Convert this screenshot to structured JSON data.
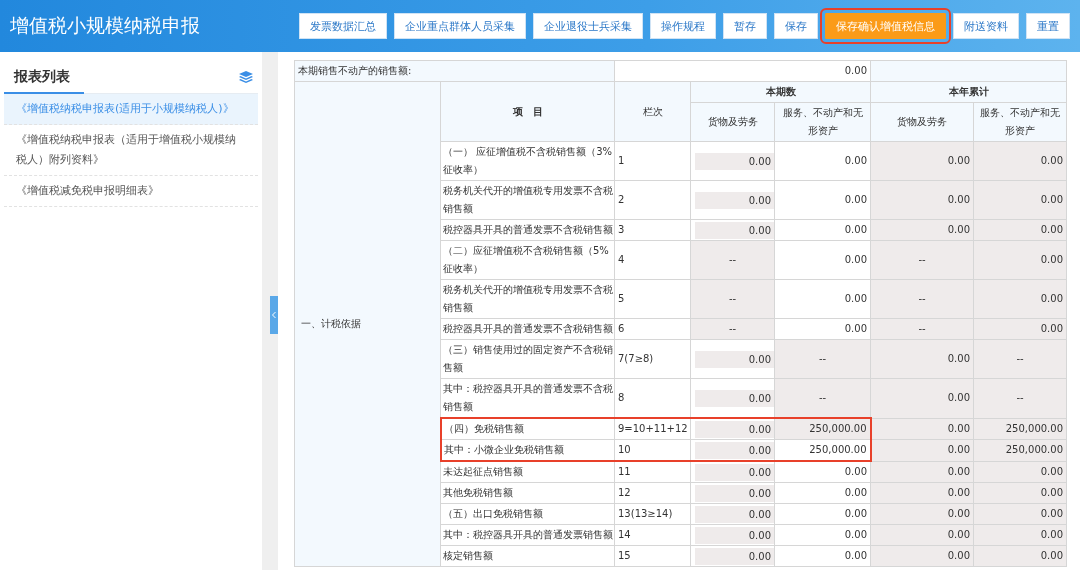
{
  "header": {
    "title": "增值税小规模纳税申报",
    "buttons": [
      {
        "label": "发票数据汇总",
        "kind": "default",
        "annotated": false
      },
      {
        "label": "企业重点群体人员采集",
        "kind": "default",
        "annotated": false
      },
      {
        "label": "企业退役士兵采集",
        "kind": "default",
        "annotated": false
      },
      {
        "label": "操作规程",
        "kind": "default",
        "annotated": false
      },
      {
        "label": "暂存",
        "kind": "default",
        "annotated": false
      },
      {
        "label": "保存",
        "kind": "default",
        "annotated": false
      },
      {
        "label": "保存确认增值税信息",
        "kind": "primary",
        "annotated": true
      },
      {
        "label": "附送资料",
        "kind": "default",
        "annotated": false
      },
      {
        "label": "重置",
        "kind": "default",
        "annotated": false
      }
    ]
  },
  "sidebar": {
    "title": "报表列表",
    "items": [
      {
        "label": "《增值税纳税申报表(适用于小规模纳税人)》",
        "selected": true
      },
      {
        "label": "《增值税纳税申报表（适用于增值税小规模纳税人）附列资料》",
        "selected": false
      },
      {
        "label": "《增值税减免税申报明细表》",
        "selected": false
      }
    ]
  },
  "table": {
    "top_row": {
      "label": "本期销售不动产的销售额:",
      "value": "0.00"
    },
    "group_label": "一、计税依据",
    "headers": {
      "item": "项　目",
      "line": "栏次",
      "current": "本期数",
      "ytd": "本年累计",
      "goods": "货物及劳务",
      "services": "服务、不动产和无形资产",
      "goods_ytd": "货物及劳务",
      "services_ytd": "服务、不动产和无形资产"
    },
    "rows": [
      {
        "item": "（一） 应征增值税不含税销售额（3%征收率）",
        "line": "1",
        "annotated": false,
        "cells": [
          {
            "text": "0.00",
            "kind": "input"
          },
          {
            "text": "0.00",
            "kind": "open"
          },
          {
            "text": "0.00",
            "kind": "locked"
          },
          {
            "text": "0.00",
            "kind": "locked"
          }
        ]
      },
      {
        "item": " 税务机关代开的增值税专用发票不含税销售额",
        "line": "2",
        "annotated": false,
        "cells": [
          {
            "text": "0.00",
            "kind": "input"
          },
          {
            "text": "0.00",
            "kind": "open"
          },
          {
            "text": "0.00",
            "kind": "locked"
          },
          {
            "text": "0.00",
            "kind": "locked"
          }
        ]
      },
      {
        "item": "税控器具开具的普通发票不含税销售额",
        "line": "3",
        "annotated": false,
        "cells": [
          {
            "text": "0.00",
            "kind": "input"
          },
          {
            "text": "0.00",
            "kind": "open"
          },
          {
            "text": "0.00",
            "kind": "locked"
          },
          {
            "text": "0.00",
            "kind": "locked"
          }
        ]
      },
      {
        "item": "（二）应征增值税不含税销售额（5%征收率）",
        "line": "4",
        "annotated": false,
        "cells": [
          {
            "text": "--",
            "kind": "locked"
          },
          {
            "text": "0.00",
            "kind": "open"
          },
          {
            "text": "--",
            "kind": "locked"
          },
          {
            "text": "0.00",
            "kind": "locked"
          }
        ]
      },
      {
        "item": "税务机关代开的增值税专用发票不含税销售额",
        "line": "5",
        "annotated": false,
        "cells": [
          {
            "text": "--",
            "kind": "locked"
          },
          {
            "text": "0.00",
            "kind": "open"
          },
          {
            "text": "--",
            "kind": "locked"
          },
          {
            "text": "0.00",
            "kind": "locked"
          }
        ]
      },
      {
        "item": "税控器具开具的普通发票不含税销售额",
        "line": "6",
        "annotated": false,
        "cells": [
          {
            "text": "--",
            "kind": "locked"
          },
          {
            "text": "0.00",
            "kind": "open"
          },
          {
            "text": "--",
            "kind": "locked"
          },
          {
            "text": "0.00",
            "kind": "locked"
          }
        ]
      },
      {
        "item": "（三）销售使用过的固定资产不含税销售额",
        "line": "7(7≥8)",
        "annotated": false,
        "cells": [
          {
            "text": "0.00",
            "kind": "input"
          },
          {
            "text": "--",
            "kind": "locked"
          },
          {
            "text": "0.00",
            "kind": "locked"
          },
          {
            "text": "--",
            "kind": "locked"
          }
        ]
      },
      {
        "item": "其中：税控器具开具的普通发票不含税销售额",
        "line": "8",
        "annotated": false,
        "cells": [
          {
            "text": "0.00",
            "kind": "input"
          },
          {
            "text": "--",
            "kind": "locked"
          },
          {
            "text": "0.00",
            "kind": "locked"
          },
          {
            "text": "--",
            "kind": "locked"
          }
        ]
      },
      {
        "item": "（四）免税销售额",
        "line": "9=10+11+12",
        "annotated": true,
        "cells": [
          {
            "text": "0.00",
            "kind": "input"
          },
          {
            "text": "250,000.00",
            "kind": "locked"
          },
          {
            "text": "0.00",
            "kind": "locked"
          },
          {
            "text": "250,000.00",
            "kind": "locked"
          }
        ]
      },
      {
        "item": "其中：小微企业免税销售额",
        "line": "10",
        "annotated": true,
        "cells": [
          {
            "text": "0.00",
            "kind": "input"
          },
          {
            "text": "250,000.00",
            "kind": "open"
          },
          {
            "text": "0.00",
            "kind": "locked"
          },
          {
            "text": "250,000.00",
            "kind": "locked"
          }
        ]
      },
      {
        "item": "未达起征点销售额",
        "line": "11",
        "annotated": false,
        "cells": [
          {
            "text": "0.00",
            "kind": "input"
          },
          {
            "text": "0.00",
            "kind": "open"
          },
          {
            "text": "0.00",
            "kind": "locked"
          },
          {
            "text": "0.00",
            "kind": "locked"
          }
        ]
      },
      {
        "item": "其他免税销售额",
        "line": "12",
        "annotated": false,
        "cells": [
          {
            "text": "0.00",
            "kind": "input"
          },
          {
            "text": "0.00",
            "kind": "open"
          },
          {
            "text": "0.00",
            "kind": "locked"
          },
          {
            "text": "0.00",
            "kind": "locked"
          }
        ]
      },
      {
        "item": "（五）出口免税销售额",
        "line": "13(13≥14)",
        "annotated": false,
        "cells": [
          {
            "text": "0.00",
            "kind": "input"
          },
          {
            "text": "0.00",
            "kind": "open"
          },
          {
            "text": "0.00",
            "kind": "locked"
          },
          {
            "text": "0.00",
            "kind": "locked"
          }
        ]
      },
      {
        "item": "其中：税控器具开具的普通发票销售额",
        "line": "14",
        "annotated": false,
        "cells": [
          {
            "text": "0.00",
            "kind": "input"
          },
          {
            "text": "0.00",
            "kind": "open"
          },
          {
            "text": "0.00",
            "kind": "locked"
          },
          {
            "text": "0.00",
            "kind": "locked"
          }
        ]
      },
      {
        "item": "核定销售额",
        "line": "15",
        "annotated": false,
        "cells": [
          {
            "text": "0.00",
            "kind": "input"
          },
          {
            "text": "0.00",
            "kind": "open"
          },
          {
            "text": "0.00",
            "kind": "locked"
          },
          {
            "text": "0.00",
            "kind": "locked"
          }
        ]
      }
    ]
  }
}
